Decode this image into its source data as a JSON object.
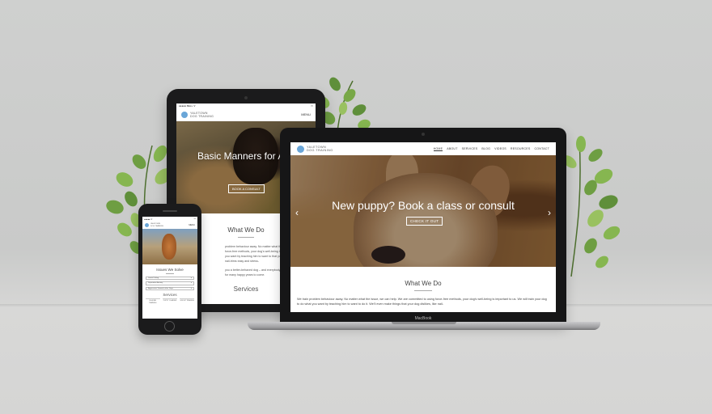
{
  "brand": {
    "line1": "YALETOWN",
    "line2": "DOG TRAINING"
  },
  "tablet": {
    "status_left": "●●●●● BELL ᯤ",
    "status_right": "▭",
    "menu": "MENU",
    "hero_title": "Basic Manners for All dogs",
    "hero_button": "BOOK A CONSULT",
    "section_title": "What We Do",
    "paragraph_1": "problem behaviour away. No matter what the issue, we are using force-free methods, your dog's well-being is our dog to do what you want by teaching him to want to that your dog dislikes, like nail-trims easy and stress-",
    "paragraph_2": "you a better-behaved dog – and everybody loves you behaviour for many happy years to come.",
    "next_section": "Services"
  },
  "laptop": {
    "nav": [
      "HOME",
      "ABOUT",
      "SERVICES",
      "BLOG",
      "VIDEOS",
      "RESOURCES",
      "CONTACT"
    ],
    "hero_title": "New puppy? Book a class or consult",
    "hero_button": "CHECK IT OUT",
    "prev_arrow": "‹",
    "next_arrow": "›",
    "section_title": "What We Do",
    "paragraph": "We train problem behaviour away. No matter what the issue, we can help. We are committed to using force-free methods, your dog's well-being is important to us. We will train your dog to do what you want by teaching him to want to do it. We'll even make things that your dog dislikes, like nail-",
    "base_label": "MacBook"
  },
  "phone": {
    "status_left": "●●●●● ᯤ",
    "status_right": "▭",
    "menu": "MENU",
    "section_title": "Issues We Solve",
    "selects": [
      "Leash Pulling",
      "Separation Anxiety",
      "Aggression Towards other Dogs"
    ],
    "select_arrow": "▾",
    "services_title": "Services",
    "services": [
      "IN-HOME TRAINING",
      "PUPPY CLASSES",
      "GROUP TRAINING"
    ]
  },
  "colors": {
    "paw": "#6aa6d8",
    "wall": "#cfd0cf",
    "device": "#1b1b1c"
  }
}
